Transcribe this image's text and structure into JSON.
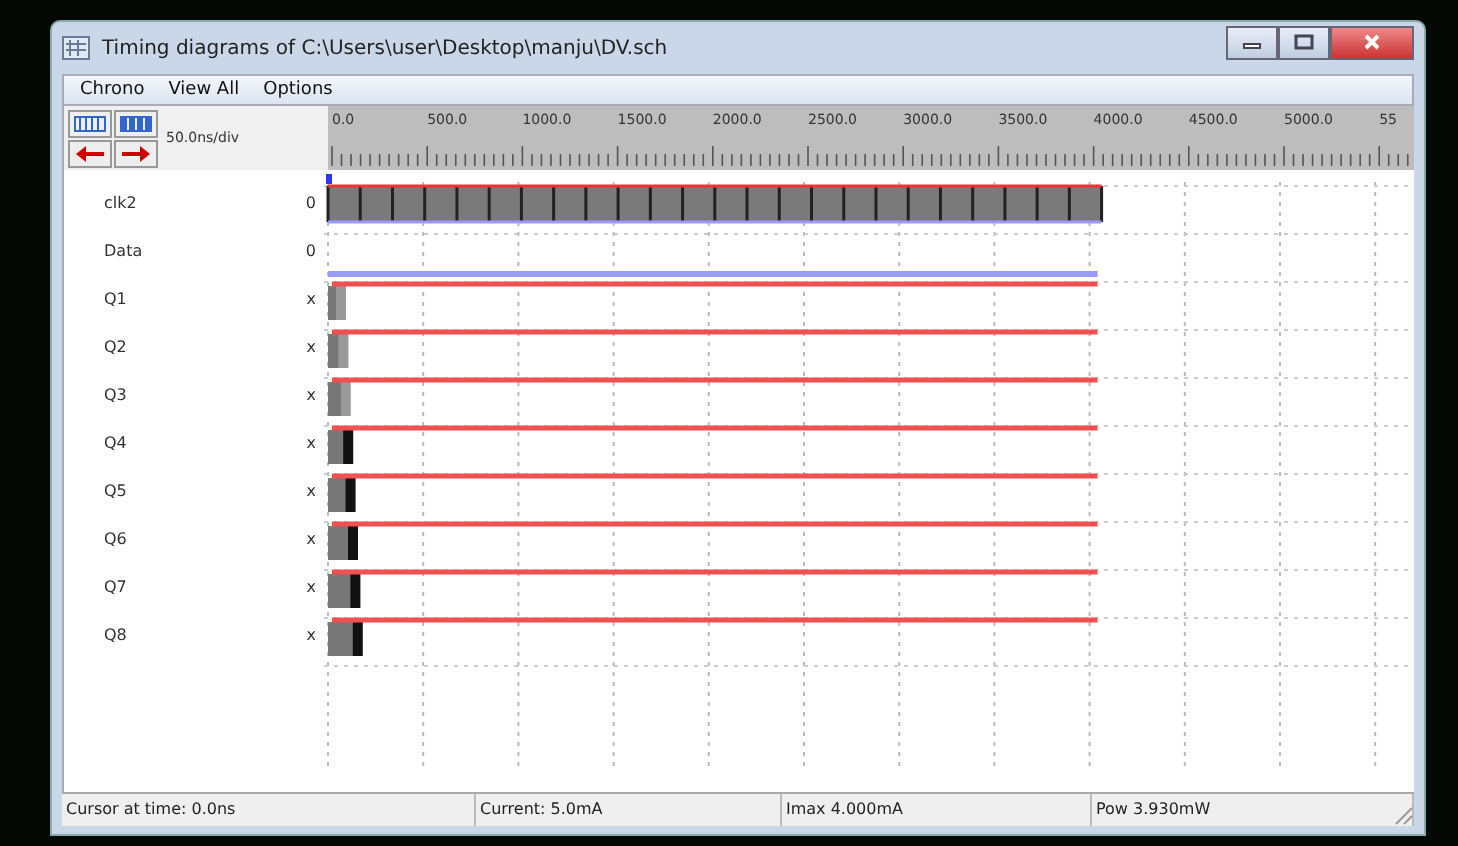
{
  "window": {
    "title": "Timing diagrams of C:\\Users\\user\\Desktop\\manju\\DV.sch"
  },
  "menu": [
    "Chrono",
    "View All",
    "Options"
  ],
  "toolbar": {
    "scale": "50.0ns/div"
  },
  "ruler": {
    "ticks": [
      "0.0",
      "500.0",
      "1000.0",
      "1500.0",
      "2000.0",
      "2500.0",
      "3000.0",
      "3500.0",
      "4000.0",
      "4500.0",
      "5000.0",
      "55"
    ]
  },
  "signals": [
    {
      "name": "clk2",
      "value": "0",
      "kind": "clock"
    },
    {
      "name": "Data",
      "value": "0",
      "kind": "low"
    },
    {
      "name": "Q1",
      "value": "x",
      "kind": "unknown"
    },
    {
      "name": "Q2",
      "value": "x",
      "kind": "unknown"
    },
    {
      "name": "Q3",
      "value": "x",
      "kind": "unknown"
    },
    {
      "name": "Q4",
      "value": "x",
      "kind": "unknown"
    },
    {
      "name": "Q5",
      "value": "x",
      "kind": "unknown"
    },
    {
      "name": "Q6",
      "value": "x",
      "kind": "unknown"
    },
    {
      "name": "Q7",
      "value": "x",
      "kind": "unknown"
    },
    {
      "name": "Q8",
      "value": "x",
      "kind": "unknown"
    }
  ],
  "status_bar": [
    "Cursor at time: 0.0ns",
    "Current: 5.0mA",
    "Imax 4.000mA",
    "Pow 3.930mW"
  ]
}
